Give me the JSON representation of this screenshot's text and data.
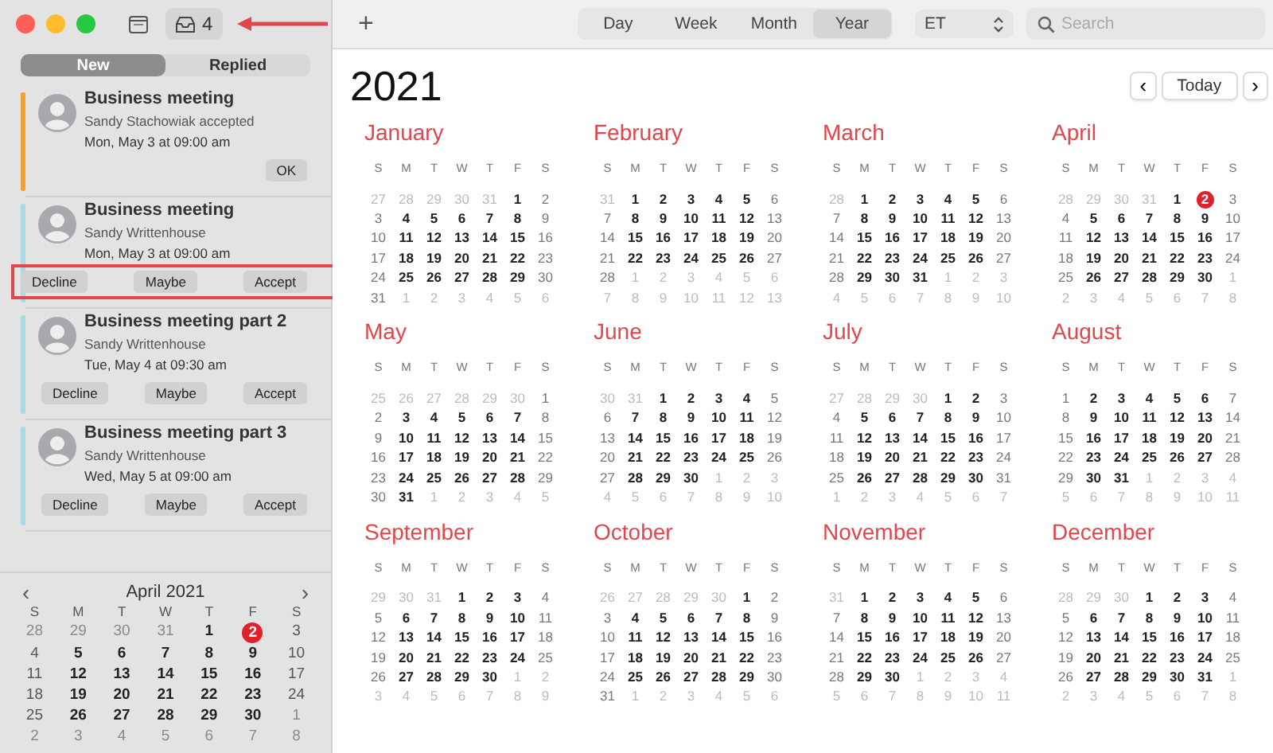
{
  "window": {
    "inbox_count": "4"
  },
  "inbox_tabs": [
    {
      "label": "New",
      "selected": true
    },
    {
      "label": "Replied",
      "selected": false
    }
  ],
  "invitations": [
    {
      "title": "Business meeting",
      "subtitle": "Sandy Stachowiak accepted",
      "time": "Mon, May 3 at 09:00 am",
      "color": "#f0a030",
      "buttons": [
        "OK"
      ],
      "highlighted": false
    },
    {
      "title": "Business meeting",
      "subtitle": "Sandy Writtenhouse",
      "time": "Mon, May 3 at 09:00 am",
      "color": "#a8dce2",
      "buttons": [
        "Decline",
        "Maybe",
        "Accept"
      ],
      "highlighted": true
    },
    {
      "title": "Business meeting part 2",
      "subtitle": "Sandy Writtenhouse",
      "time": "Tue, May 4 at 09:30 am",
      "color": "#a8dce2",
      "buttons": [
        "Decline",
        "Maybe",
        "Accept"
      ],
      "highlighted": false
    },
    {
      "title": "Business meeting part 3",
      "subtitle": "Sandy Writtenhouse",
      "time": "Wed, May 5 at 09:00 am",
      "color": "#a8dce2",
      "buttons": [
        "Decline",
        "Maybe",
        "Accept"
      ],
      "highlighted": false
    }
  ],
  "mini_calendar": {
    "title": "April 2021",
    "prev": "‹",
    "next": "›",
    "weekdays": [
      "S",
      "M",
      "T",
      "W",
      "T",
      "F",
      "S"
    ],
    "prev_days": [
      "28",
      "29",
      "30",
      "31"
    ],
    "days": [
      "1",
      {
        "label": "2",
        "today": true
      },
      "3",
      "4",
      "5",
      "6",
      "7",
      "8",
      "9",
      "10",
      "11",
      "12",
      "13",
      "14",
      "15",
      "16",
      "17",
      "18",
      "19",
      "20",
      "21",
      "22",
      "23",
      "24",
      "25",
      "26",
      "27",
      "28",
      "29",
      "30"
    ],
    "next_days": [
      "1",
      "2",
      "3",
      "4",
      "5",
      "6",
      "7",
      "8"
    ]
  },
  "toolbar": {
    "add": "+",
    "views": [
      {
        "label": "Day",
        "selected": false
      },
      {
        "label": "Week",
        "selected": false
      },
      {
        "label": "Month",
        "selected": false
      },
      {
        "label": "Year",
        "selected": true
      }
    ],
    "timezone": "ET",
    "search": {
      "placeholder": "Search"
    }
  },
  "year": "2021",
  "today_button": "Today",
  "prev": "‹",
  "next": "›",
  "months": [
    {
      "name": "January",
      "weekdays": [
        "S",
        "M",
        "T",
        "W",
        "T",
        "F",
        "S"
      ],
      "prev_days": [
        "27",
        "28",
        "29",
        "30",
        "31"
      ],
      "days": [
        "1",
        "2",
        "3",
        "4",
        "5",
        "6",
        "7",
        "8",
        "9",
        "10",
        "11",
        "12",
        "13",
        "14",
        "15",
        "16",
        "17",
        "18",
        "19",
        "20",
        "21",
        "22",
        "23",
        "24",
        "25",
        "26",
        "27",
        "28",
        "29",
        "30",
        "31"
      ],
      "next_days": [
        "1",
        "2",
        "3",
        "4",
        "5",
        "6"
      ]
    },
    {
      "name": "February",
      "weekdays": [
        "S",
        "M",
        "T",
        "W",
        "T",
        "F",
        "S"
      ],
      "prev_days": [
        "31"
      ],
      "days": [
        "1",
        "2",
        "3",
        "4",
        "5",
        "6",
        "7",
        "8",
        "9",
        "10",
        "11",
        "12",
        "13",
        "14",
        "15",
        "16",
        "17",
        "18",
        "19",
        "20",
        "21",
        "22",
        "23",
        "24",
        "25",
        "26",
        "27",
        "28"
      ],
      "next_days": [
        "1",
        "2",
        "3",
        "4",
        "5",
        "6",
        "7",
        "8",
        "9",
        "10",
        "11",
        "12",
        "13"
      ]
    },
    {
      "name": "March",
      "weekdays": [
        "S",
        "M",
        "T",
        "W",
        "T",
        "F",
        "S"
      ],
      "prev_days": [
        "28"
      ],
      "days": [
        "1",
        "2",
        "3",
        "4",
        "5",
        "6",
        "7",
        "8",
        "9",
        "10",
        "11",
        "12",
        "13",
        "14",
        "15",
        "16",
        "17",
        "18",
        "19",
        "20",
        "21",
        "22",
        "23",
        "24",
        "25",
        "26",
        "27",
        "28",
        "29",
        "30",
        "31"
      ],
      "next_days": [
        "1",
        "2",
        "3",
        "4",
        "5",
        "6",
        "7",
        "8",
        "9",
        "10"
      ]
    },
    {
      "name": "April",
      "weekdays": [
        "S",
        "M",
        "T",
        "W",
        "T",
        "F",
        "S"
      ],
      "prev_days": [
        "28",
        "29",
        "30",
        "31"
      ],
      "days": [
        "1",
        {
          "label": "2",
          "today": true
        },
        "3",
        "4",
        "5",
        "6",
        "7",
        "8",
        "9",
        "10",
        "11",
        "12",
        "13",
        "14",
        "15",
        "16",
        "17",
        "18",
        "19",
        "20",
        "21",
        "22",
        "23",
        "24",
        "25",
        "26",
        "27",
        "28",
        "29",
        "30"
      ],
      "next_days": [
        "1",
        "2",
        "3",
        "4",
        "5",
        "6",
        "7",
        "8"
      ]
    },
    {
      "name": "May",
      "weekdays": [
        "S",
        "M",
        "T",
        "W",
        "T",
        "F",
        "S"
      ],
      "prev_days": [
        "25",
        "26",
        "27",
        "28",
        "29",
        "30"
      ],
      "days": [
        "1",
        "2",
        "3",
        "4",
        "5",
        "6",
        "7",
        "8",
        "9",
        "10",
        "11",
        "12",
        "13",
        "14",
        "15",
        "16",
        "17",
        "18",
        "19",
        "20",
        "21",
        "22",
        "23",
        "24",
        "25",
        "26",
        "27",
        "28",
        "29",
        "30",
        "31"
      ],
      "next_days": [
        "1",
        "2",
        "3",
        "4",
        "5"
      ]
    },
    {
      "name": "June",
      "weekdays": [
        "S",
        "M",
        "T",
        "W",
        "T",
        "F",
        "S"
      ],
      "prev_days": [
        "30",
        "31"
      ],
      "days": [
        "1",
        "2",
        "3",
        "4",
        "5",
        "6",
        "7",
        "8",
        "9",
        "10",
        "11",
        "12",
        "13",
        "14",
        "15",
        "16",
        "17",
        "18",
        "19",
        "20",
        "21",
        "22",
        "23",
        "24",
        "25",
        "26",
        "27",
        "28",
        "29",
        "30"
      ],
      "next_days": [
        "1",
        "2",
        "3",
        "4",
        "5",
        "6",
        "7",
        "8",
        "9",
        "10"
      ]
    },
    {
      "name": "July",
      "weekdays": [
        "S",
        "M",
        "T",
        "W",
        "T",
        "F",
        "S"
      ],
      "prev_days": [
        "27",
        "28",
        "29",
        "30"
      ],
      "days": [
        "1",
        "2",
        "3",
        "4",
        "5",
        "6",
        "7",
        "8",
        "9",
        "10",
        "11",
        "12",
        "13",
        "14",
        "15",
        "16",
        "17",
        "18",
        "19",
        "20",
        "21",
        "22",
        "23",
        "24",
        "25",
        "26",
        "27",
        "28",
        "29",
        "30",
        "31"
      ],
      "next_days": [
        "1",
        "2",
        "3",
        "4",
        "5",
        "6",
        "7"
      ]
    },
    {
      "name": "August",
      "weekdays": [
        "S",
        "M",
        "T",
        "W",
        "T",
        "F",
        "S"
      ],
      "days": [
        "1",
        "2",
        "3",
        "4",
        "5",
        "6",
        "7",
        "8",
        "9",
        "10",
        "11",
        "12",
        "13",
        "14",
        "15",
        "16",
        "17",
        "18",
        "19",
        "20",
        "21",
        "22",
        "23",
        "24",
        "25",
        "26",
        "27",
        "28",
        "29",
        "30",
        "31"
      ],
      "next_days": [
        "1",
        "2",
        "3",
        "4",
        "5",
        "6",
        "7",
        "8",
        "9",
        "10",
        "11"
      ]
    },
    {
      "name": "September",
      "weekdays": [
        "S",
        "M",
        "T",
        "W",
        "T",
        "F",
        "S"
      ],
      "prev_days": [
        "29",
        "30",
        "31"
      ],
      "days": [
        "1",
        "2",
        "3",
        "4",
        "5",
        "6",
        "7",
        "8",
        "9",
        "10",
        "11",
        "12",
        "13",
        "14",
        "15",
        "16",
        "17",
        "18",
        "19",
        "20",
        "21",
        "22",
        "23",
        "24",
        "25",
        "26",
        "27",
        "28",
        "29",
        "30"
      ],
      "next_days": [
        "1",
        "2",
        "3",
        "4",
        "5",
        "6",
        "7",
        "8",
        "9"
      ]
    },
    {
      "name": "October",
      "weekdays": [
        "S",
        "M",
        "T",
        "W",
        "T",
        "F",
        "S"
      ],
      "prev_days": [
        "26",
        "27",
        "28",
        "29",
        "30"
      ],
      "days": [
        "1",
        "2",
        "3",
        "4",
        "5",
        "6",
        "7",
        "8",
        "9",
        "10",
        "11",
        "12",
        "13",
        "14",
        "15",
        "16",
        "17",
        "18",
        "19",
        "20",
        "21",
        "22",
        "23",
        "24",
        "25",
        "26",
        "27",
        "28",
        "29",
        "30",
        "31"
      ],
      "next_days": [
        "1",
        "2",
        "3",
        "4",
        "5",
        "6"
      ]
    },
    {
      "name": "November",
      "weekdays": [
        "S",
        "M",
        "T",
        "W",
        "T",
        "F",
        "S"
      ],
      "prev_days": [
        "31"
      ],
      "days": [
        "1",
        "2",
        "3",
        "4",
        "5",
        "6",
        "7",
        "8",
        "9",
        "10",
        "11",
        "12",
        "13",
        "14",
        "15",
        "16",
        "17",
        "18",
        "19",
        "20",
        "21",
        "22",
        "23",
        "24",
        "25",
        "26",
        "27",
        "28",
        "29",
        "30"
      ],
      "next_days": [
        "1",
        "2",
        "3",
        "4",
        "5",
        "6",
        "7",
        "8",
        "9",
        "10",
        "11"
      ]
    },
    {
      "name": "December",
      "weekdays": [
        "S",
        "M",
        "T",
        "W",
        "T",
        "F",
        "S"
      ],
      "prev_days": [
        "28",
        "29",
        "30"
      ],
      "days": [
        "1",
        "2",
        "3",
        "4",
        "5",
        "6",
        "7",
        "8",
        "9",
        "10",
        "11",
        "12",
        "13",
        "14",
        "15",
        "16",
        "17",
        "18",
        "19",
        "20",
        "21",
        "22",
        "23",
        "24",
        "25",
        "26",
        "27",
        "28",
        "29",
        "30",
        "31"
      ],
      "next_days": [
        "1",
        "2",
        "3",
        "4",
        "5",
        "6",
        "7",
        "8"
      ]
    }
  ]
}
